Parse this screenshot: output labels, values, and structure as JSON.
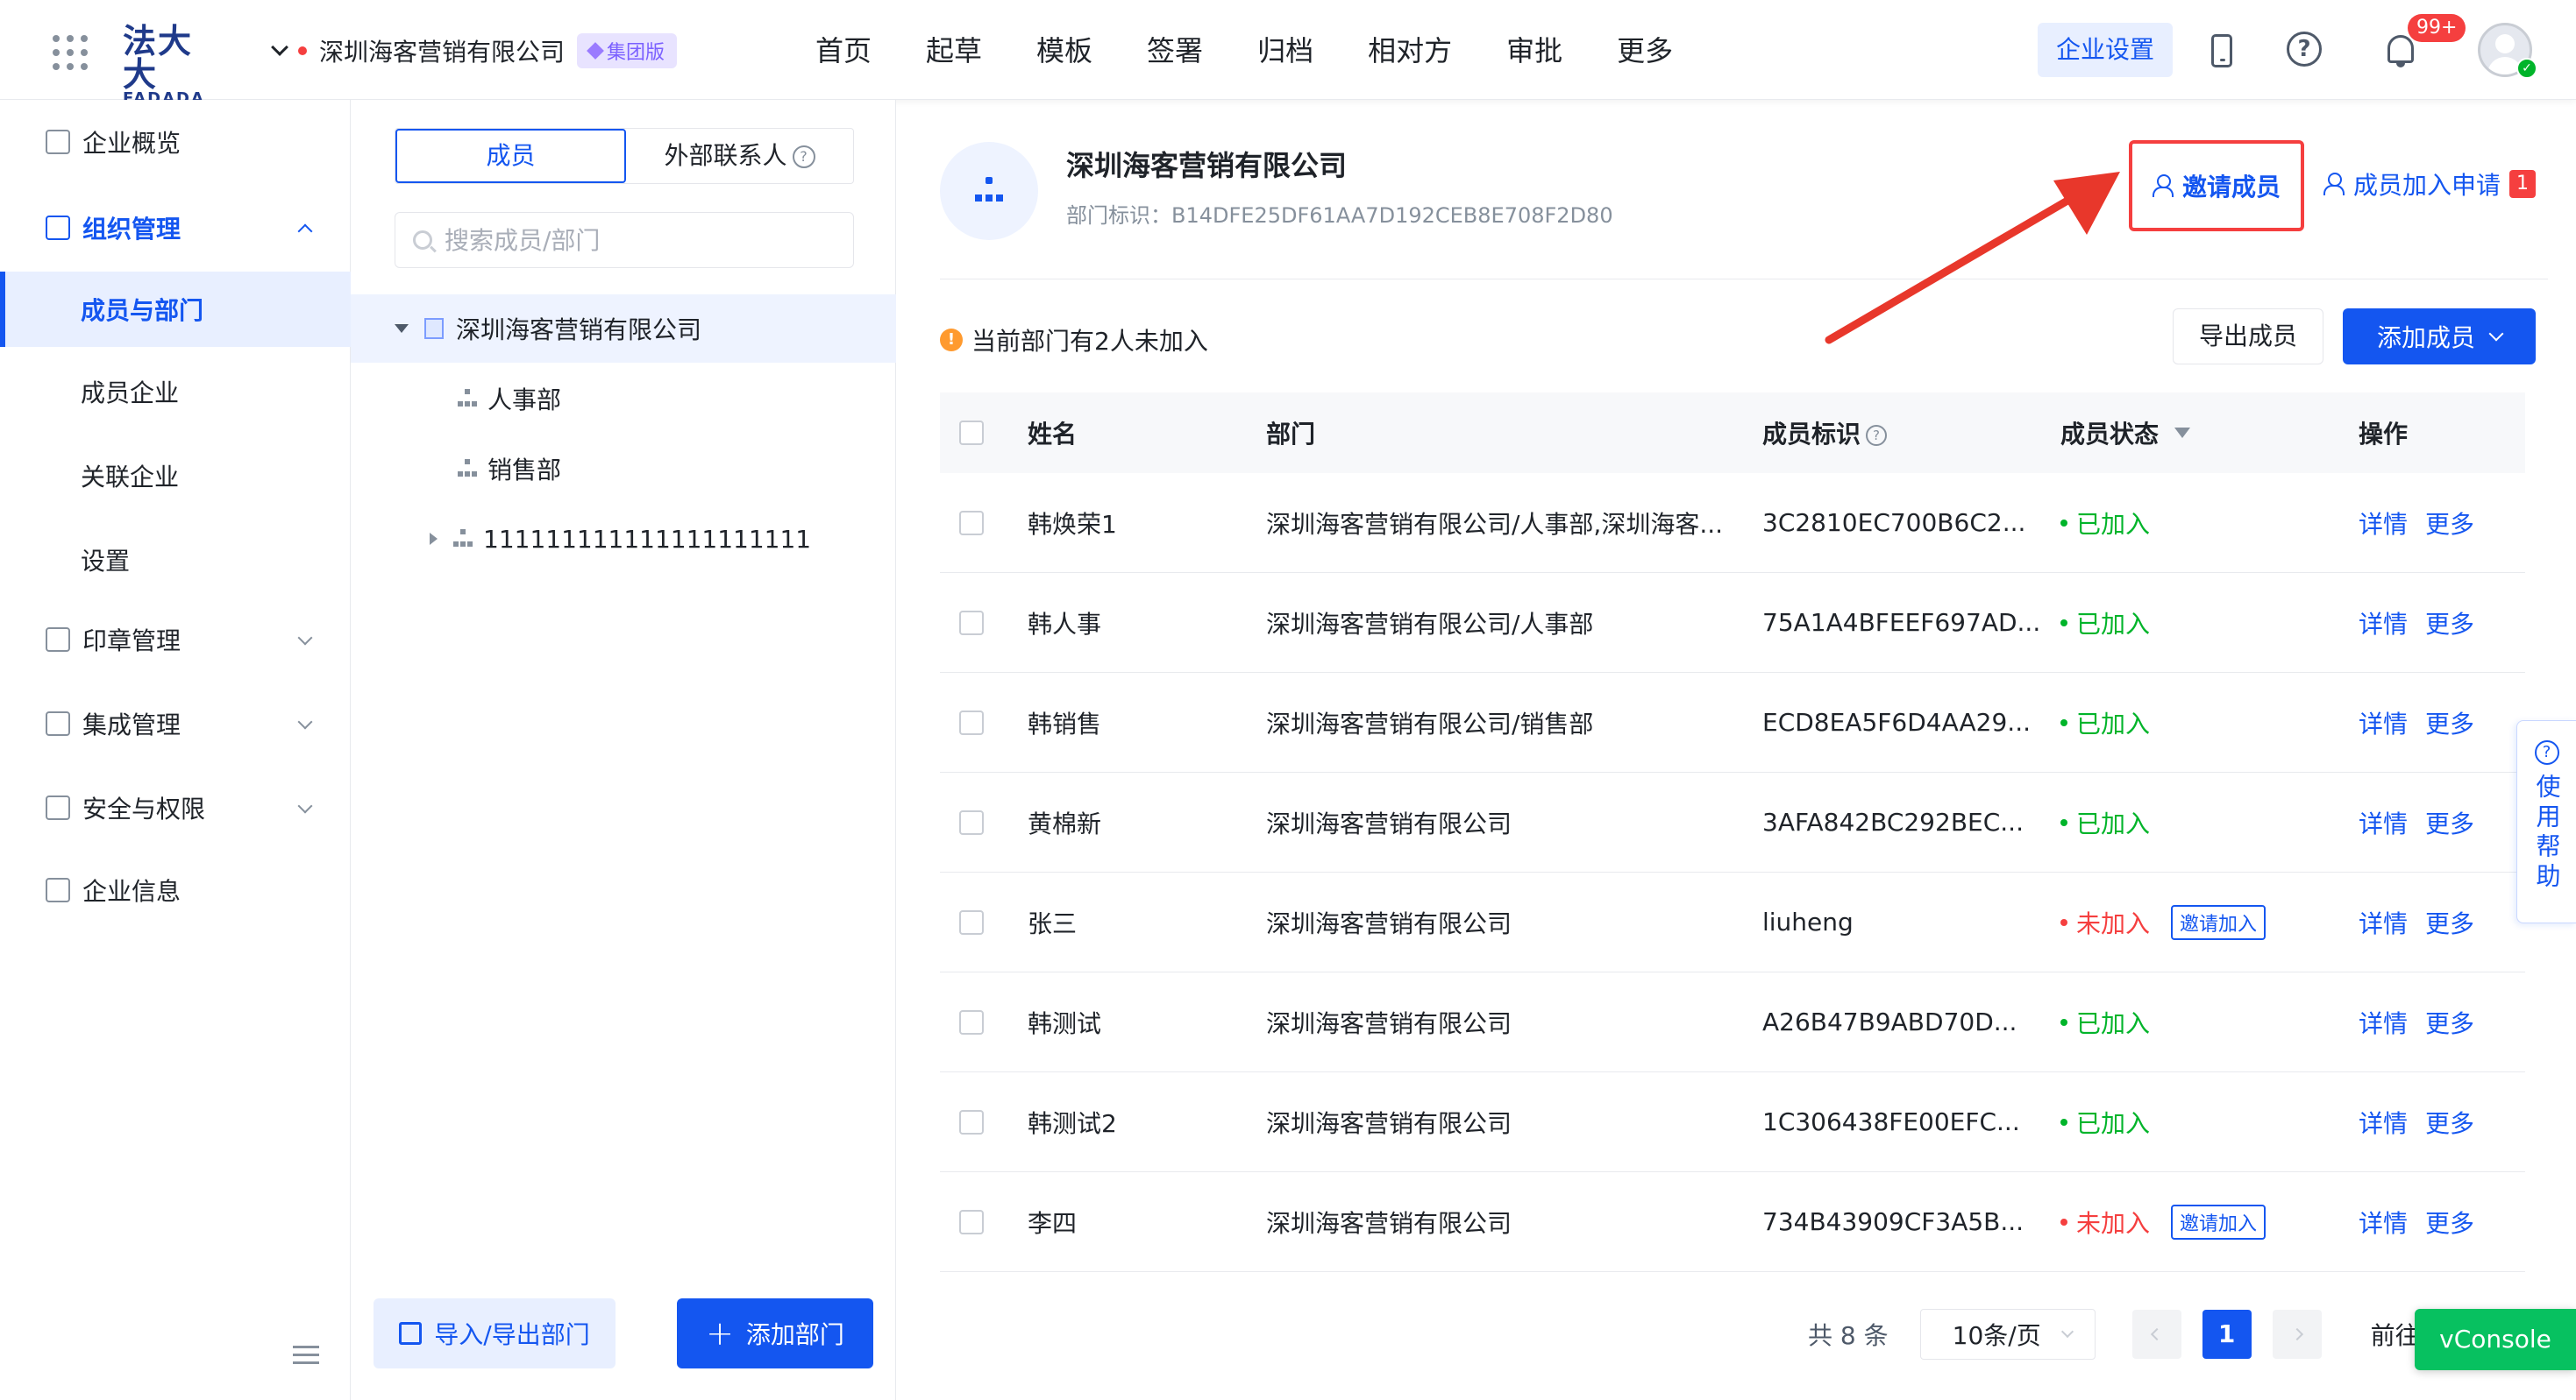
{
  "header": {
    "logo_main": "法大大",
    "logo_sub": "FADADA",
    "company": "深圳海客营销有限公司",
    "edition_badge": "集团版",
    "nav": [
      "首页",
      "起草",
      "模板",
      "签署",
      "归档",
      "相对方",
      "审批",
      "更多"
    ],
    "corp_settings": "企业设置",
    "notification_count": "99+",
    "icons": [
      "apps-grid-icon",
      "phone-icon",
      "help-icon",
      "bell-icon",
      "avatar"
    ]
  },
  "sidebar": {
    "items": [
      {
        "label": "企业概览",
        "icon": "overview-icon"
      },
      {
        "label": "组织管理",
        "icon": "org-icon",
        "expanded": true
      },
      {
        "label": "成员与部门",
        "sub": true,
        "active": true
      },
      {
        "label": "成员企业",
        "sub": true
      },
      {
        "label": "关联企业",
        "sub": true
      },
      {
        "label": "设置",
        "sub": true
      },
      {
        "label": "印章管理",
        "icon": "seal-icon"
      },
      {
        "label": "集成管理",
        "icon": "layers-icon"
      },
      {
        "label": "安全与权限",
        "icon": "key-icon"
      },
      {
        "label": "企业信息",
        "icon": "building-icon"
      }
    ]
  },
  "dept_panel": {
    "tabs": [
      "成员",
      "外部联系人"
    ],
    "active_tab": "成员",
    "search_placeholder": "搜索成员/部门",
    "tree": [
      {
        "label": "深圳海客营销有限公司",
        "level": 0,
        "expanded": true,
        "selected": true
      },
      {
        "label": "人事部",
        "level": 1
      },
      {
        "label": "销售部",
        "level": 1
      },
      {
        "label": "111111111111111111111",
        "level": 1,
        "has_children": true
      }
    ],
    "import_export_label": "导入/导出部门",
    "add_dept_label": "添加部门"
  },
  "main": {
    "company_name": "深圳海客营销有限公司",
    "dept_id_label": "部门标识：B14DFE25DF61AA7D192CEB8E708F2D80",
    "invite_label": "邀请成员",
    "join_request_label": "成员加入申请",
    "join_request_count": "1",
    "warning_text": "当前部门有2人未加入",
    "export_label": "导出成员",
    "add_member_label": "添加成员",
    "columns": [
      "姓名",
      "部门",
      "成员标识",
      "成员状态",
      "操作"
    ],
    "rows": [
      {
        "name": "韩焕荣1",
        "dept": "深圳海客营销有限公司/人事部,深圳海客...",
        "id": "3C2810EC700B6C2...",
        "status": "已加入",
        "joined": true
      },
      {
        "name": "韩人事",
        "dept": "深圳海客营销有限公司/人事部",
        "id": "75A1A4BFEEF697AD...",
        "status": "已加入",
        "joined": true
      },
      {
        "name": "韩销售",
        "dept": "深圳海客营销有限公司/销售部",
        "id": "ECD8EA5F6D4AA29...",
        "status": "已加入",
        "joined": true
      },
      {
        "name": "黄棉新",
        "dept": "深圳海客营销有限公司",
        "id": "3AFA842BC292BEC...",
        "status": "已加入",
        "joined": true
      },
      {
        "name": "张三",
        "dept": "深圳海客营销有限公司",
        "id": "liuheng",
        "status": "未加入",
        "joined": false,
        "invite": "邀请加入"
      },
      {
        "name": "韩测试",
        "dept": "深圳海客营销有限公司",
        "id": "A26B47B9ABD70D...",
        "status": "已加入",
        "joined": true
      },
      {
        "name": "韩测试2",
        "dept": "深圳海客营销有限公司",
        "id": "1C306438FE00EFC...",
        "status": "已加入",
        "joined": true
      },
      {
        "name": "李四",
        "dept": "深圳海客营销有限公司",
        "id": "734B43909CF3A5B...",
        "status": "未加入",
        "joined": false,
        "invite": "邀请加入"
      }
    ],
    "row_actions": [
      "详情",
      "更多"
    ],
    "pagination": {
      "total": "共 8 条",
      "page_size": "10条/页",
      "current_page": "1",
      "goto": "前往"
    }
  },
  "help_tab": "使用帮助",
  "vconsole": "vConsole",
  "colors": {
    "primary": "#1456f0",
    "joined": "#00b42a",
    "not_joined": "#f53f3f",
    "annotation": "#e8372b"
  }
}
